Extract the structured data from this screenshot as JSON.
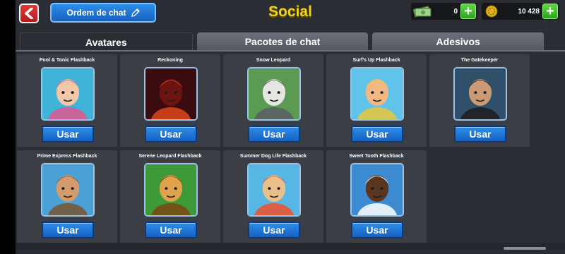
{
  "title": "Social",
  "order_button": {
    "label": "Ordem de chat"
  },
  "currency": {
    "cash": "0",
    "coins": "10 428"
  },
  "tabs": [
    {
      "label": "Avatares",
      "active": true
    },
    {
      "label": "Pacotes de chat",
      "active": false
    },
    {
      "label": "Adesivos",
      "active": false
    }
  ],
  "avatars": [
    {
      "name": "Pool & Tonic Flashback",
      "button": "Usar",
      "bg": "#3fb4d8",
      "skin": "#f2c7a7",
      "hair": "#e0568e"
    },
    {
      "name": "Reckoning",
      "button": "Usar",
      "bg": "#3a0b0f",
      "skin": "#6e1410",
      "hair": "#e0461b"
    },
    {
      "name": "Snow Leopard",
      "button": "Usar",
      "bg": "#5a9a52",
      "skin": "#e5e6e1",
      "hair": "#5b5e66"
    },
    {
      "name": "Surf's Up Flashback",
      "button": "Usar",
      "bg": "#5fc3ea",
      "skin": "#f1b884",
      "hair": "#e9c63a"
    },
    {
      "name": "The Gatekeeper",
      "button": "Usar",
      "bg": "#30506a",
      "skin": "#c99a75",
      "hair": "#1d1d1f"
    },
    {
      "name": "Prime Express Flashback",
      "button": "Usar",
      "bg": "#4ba1d6",
      "skin": "#d49c6e",
      "hair": "#7a5531"
    },
    {
      "name": "Serene Leopard Flashback",
      "button": "Usar",
      "bg": "#3e9a39",
      "skin": "#e0a24b",
      "hair": "#7a4512"
    },
    {
      "name": "Summer Dog Life Flashback",
      "button": "Usar",
      "bg": "#56b7e4",
      "skin": "#e9c08a",
      "hair": "#f2502c"
    },
    {
      "name": "Sweet Tooth Flashback",
      "button": "Usar",
      "bg": "#3c8bd0",
      "skin": "#5a3520",
      "hair": "#ffffff"
    }
  ]
}
